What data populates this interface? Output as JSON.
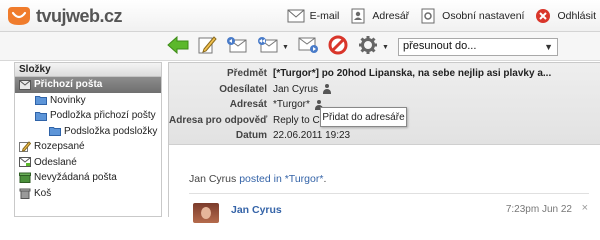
{
  "app": {
    "logo_text": "tvujweb.cz",
    "brand_color": "#f07c2c"
  },
  "toplinks": [
    {
      "label": "E-mail",
      "icon": "mail-icon"
    },
    {
      "label": "Adresář",
      "icon": "address-book-icon"
    },
    {
      "label": "Osobní nastavení",
      "icon": "settings-page-icon"
    },
    {
      "label": "Odhlásit",
      "icon": "logout-icon"
    }
  ],
  "toolbar": {
    "buttons": [
      "back-arrow-icon",
      "compose-icon",
      "reply-icon",
      "reply-all-icon",
      "forward-icon",
      "delete-icon",
      "gear-icon"
    ],
    "move_select": "přesunout do..."
  },
  "folders": {
    "title": "Složky",
    "items": [
      {
        "label": "Přichozí pošta",
        "icon": "inbox-icon",
        "active": true
      },
      {
        "label": "Novinky",
        "icon": "folder-icon"
      },
      {
        "label": "Podložka přichozí pošty",
        "icon": "folder-icon"
      },
      {
        "label": "Podsložka podsložky",
        "icon": "folder-icon"
      },
      {
        "label": "Rozepsané",
        "icon": "draft-icon"
      },
      {
        "label": "Odeslané",
        "icon": "sent-icon"
      },
      {
        "label": "Nevyžádaná pošta",
        "icon": "spam-icon"
      },
      {
        "label": "Koš",
        "icon": "trash-icon"
      }
    ]
  },
  "message": {
    "headers": [
      {
        "label": "Předmět",
        "value": "[*Turgor*] po 20hod Lipanska, na sebe nejlip asi plavky a..."
      },
      {
        "label": "Odesílatel",
        "value": "Jan Cyrus"
      },
      {
        "label": "Adresát",
        "value": "*Turgor*"
      },
      {
        "label": "Adresa pro odpověď",
        "value": "Reply to Co"
      },
      {
        "label": "Datum",
        "value": "22.06.2011 19:23"
      }
    ],
    "tooltip": "Přidat do adresáře",
    "posted_prefix": "Jan Cyrus ",
    "posted_link": "posted in *Turgor*",
    "posted_suffix": ".",
    "author": "Jan Cyrus",
    "time": "7:23pm Jun 22",
    "close": "×"
  }
}
